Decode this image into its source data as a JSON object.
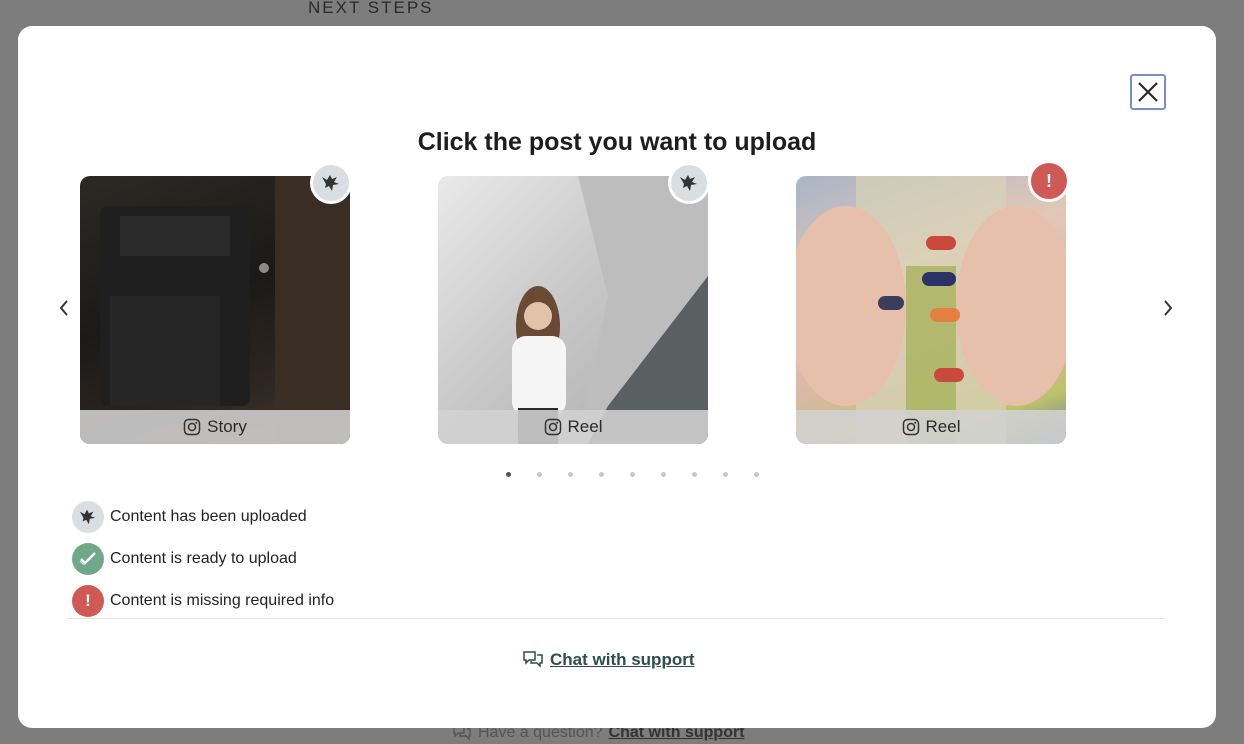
{
  "background": {
    "heading": "NEXT STEPS",
    "question_text": "Have a question?",
    "chat_link": "Chat with support"
  },
  "modal": {
    "title": "Click the post you want to upload",
    "close_icon": "close-icon",
    "prev_icon": "chevron-left-icon",
    "next_icon": "chevron-right-icon",
    "posts": [
      {
        "label": "Story",
        "status": "uploaded",
        "platform_icon": "instagram-icon"
      },
      {
        "label": "Reel",
        "status": "uploaded",
        "platform_icon": "instagram-icon"
      },
      {
        "label": "Reel",
        "status": "missing",
        "platform_icon": "instagram-icon",
        "badge_text": "!"
      }
    ],
    "pagination": {
      "total": 9,
      "current": 1
    },
    "legend": [
      {
        "icon": "bird-icon",
        "label": "Content has been uploaded"
      },
      {
        "icon": "check-icon",
        "label": "Content is ready to upload"
      },
      {
        "icon": "exclamation-icon",
        "label": "Content is missing required info",
        "glyph": "!"
      }
    ],
    "support_link": "Chat with support"
  },
  "colors": {
    "uploaded_badge": "#d8dee2",
    "ready_badge": "#6fa98a",
    "error_badge": "#cf5a55",
    "support_link": "#2e4f46"
  }
}
